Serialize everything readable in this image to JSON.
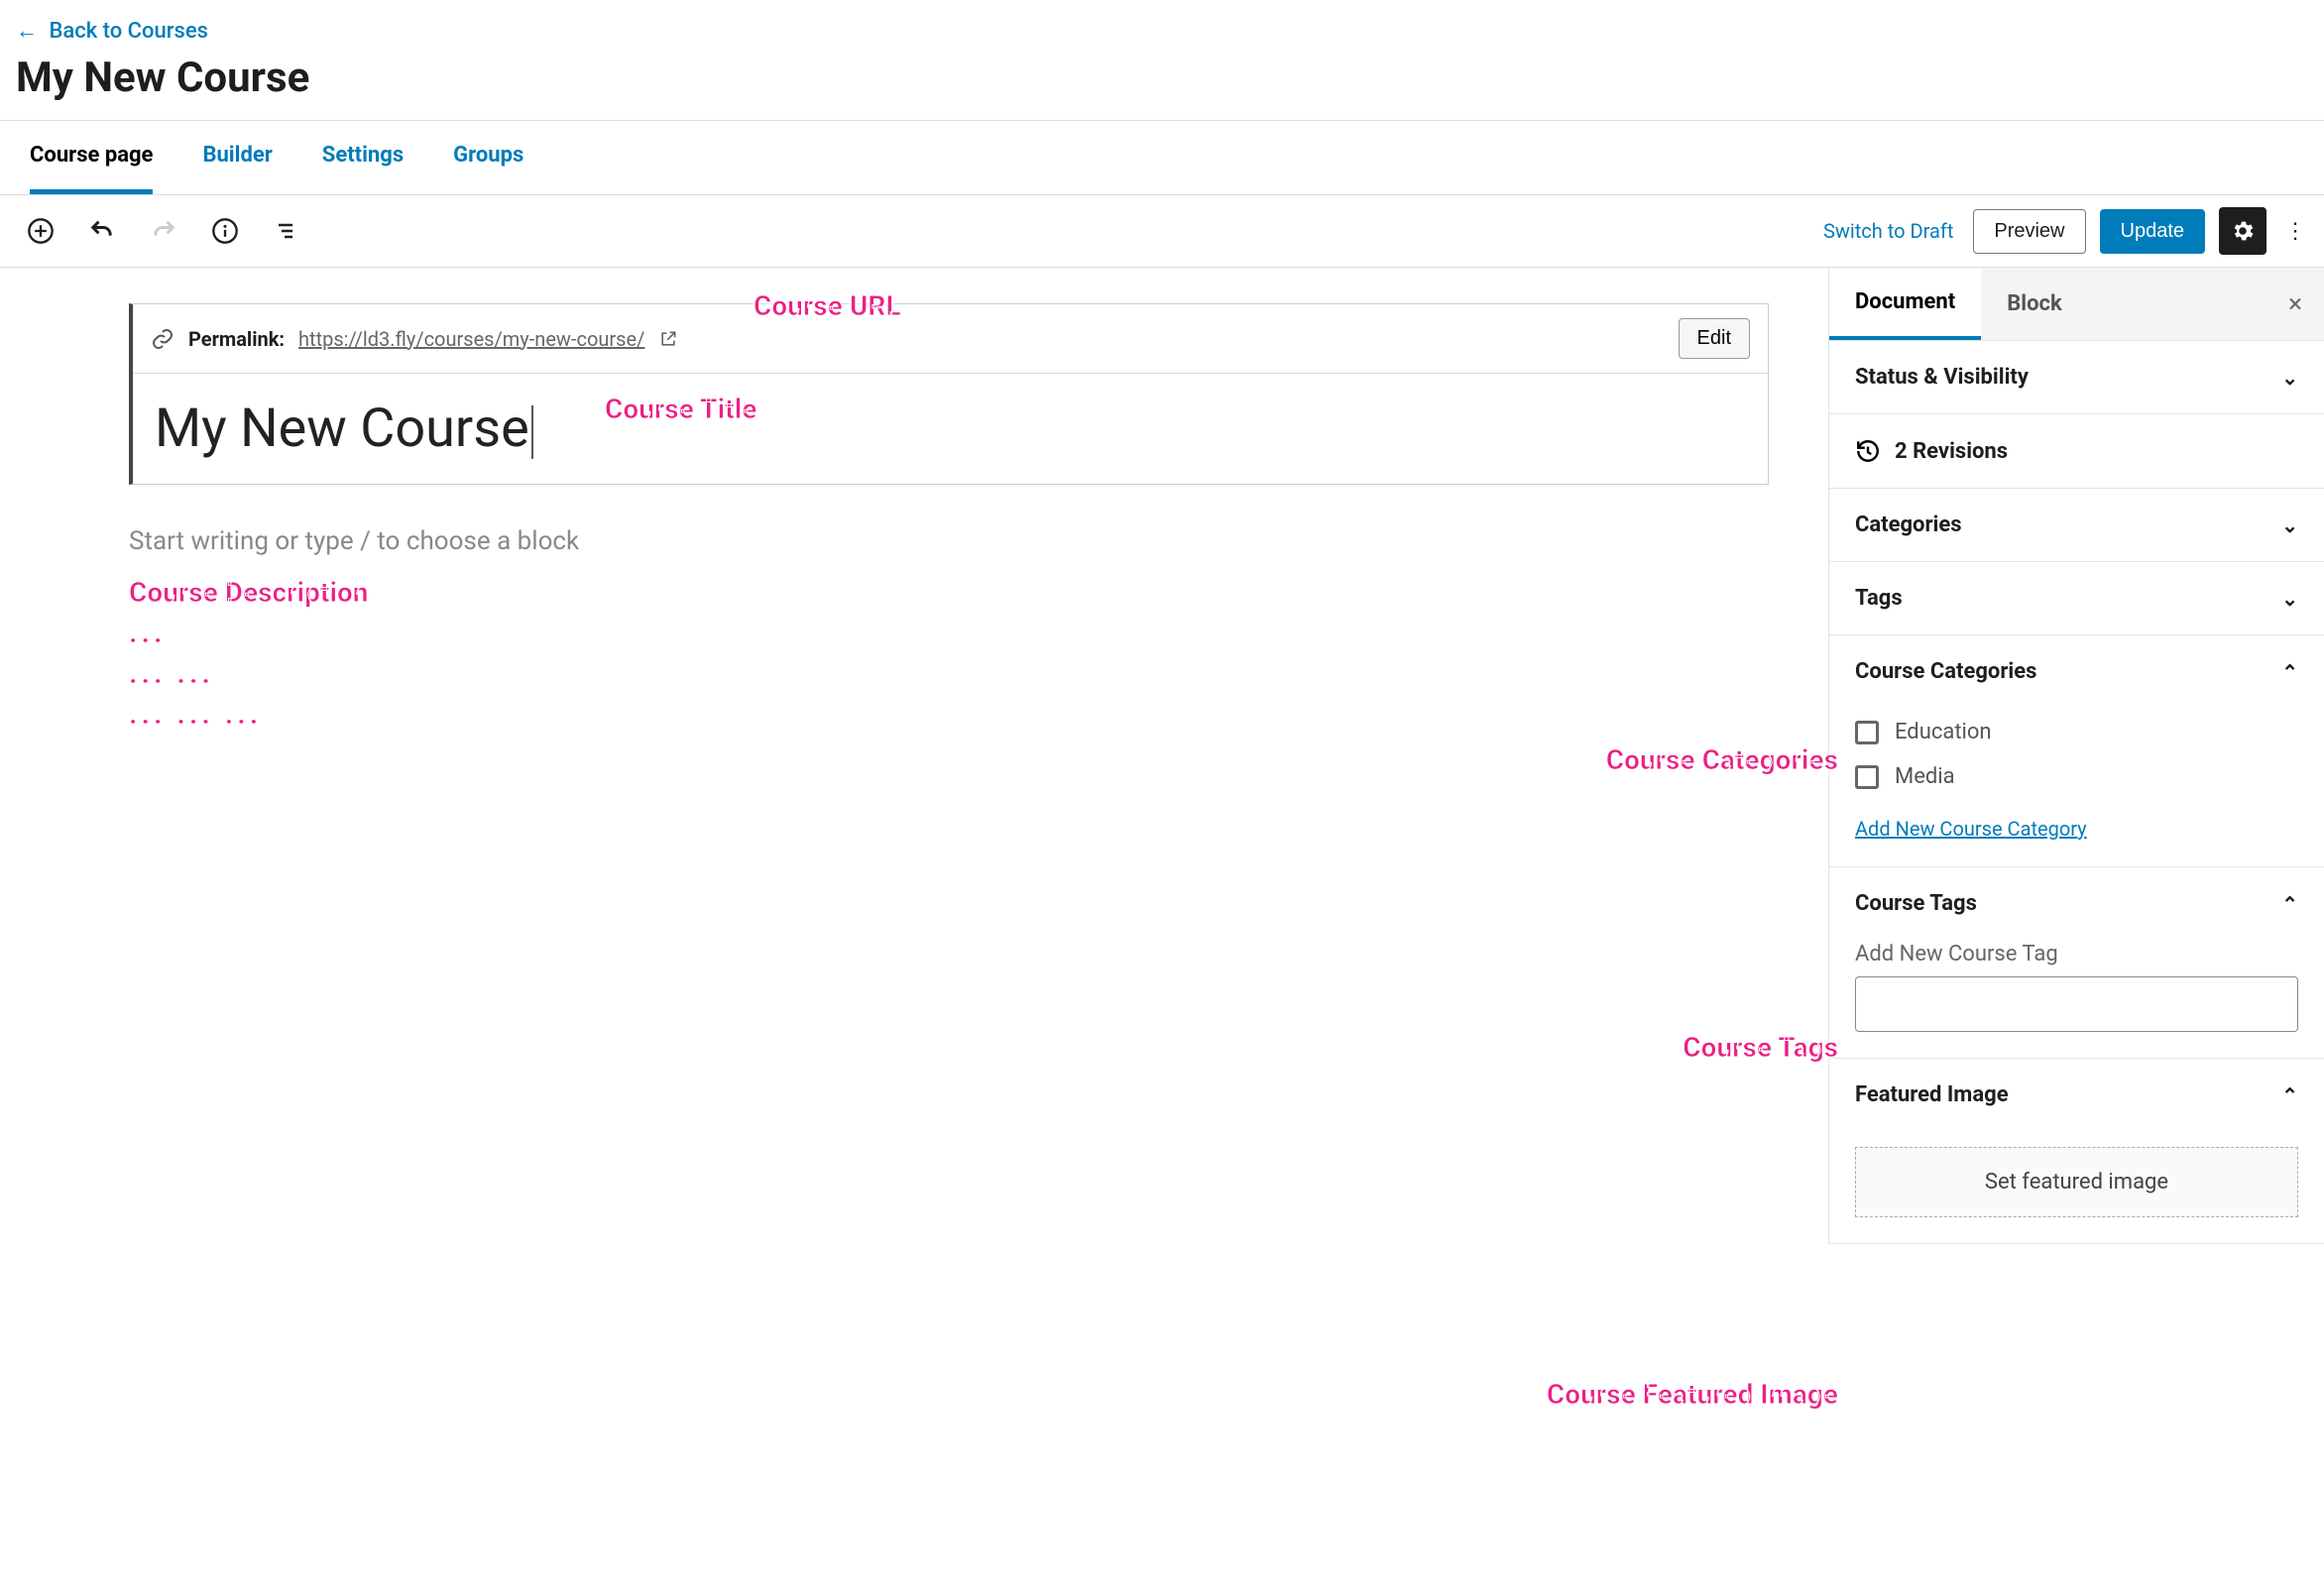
{
  "back_link": "Back to Courses",
  "page_title": "My New Course",
  "tabs": {
    "course_page": "Course page",
    "builder": "Builder",
    "settings": "Settings",
    "groups": "Groups"
  },
  "toolbar": {
    "switch_draft": "Switch to Draft",
    "preview": "Preview",
    "update": "Update"
  },
  "permalink": {
    "label": "Permalink:",
    "url": "https://ld3.fly/courses/my-new-course/",
    "edit": "Edit"
  },
  "title_value": "My New Course",
  "content_placeholder": "Start writing or type / to choose a block",
  "inspector": {
    "tab_document": "Document",
    "tab_block": "Block",
    "status_visibility": "Status & Visibility",
    "revisions": "2 Revisions",
    "categories": "Categories",
    "tags": "Tags",
    "course_categories": "Course Categories",
    "cat_option_1": "Education",
    "cat_option_2": "Media",
    "add_category": "Add New Course Category",
    "course_tags": "Course Tags",
    "add_tag_label": "Add New Course Tag",
    "featured_image": "Featured Image",
    "set_featured": "Set featured image"
  },
  "annotations": {
    "url": "Course URL",
    "title": "Course Title",
    "description": "Course Description",
    "categories": "Course Categories",
    "tags": "Course Tags",
    "featured": "Course Featured Image"
  }
}
